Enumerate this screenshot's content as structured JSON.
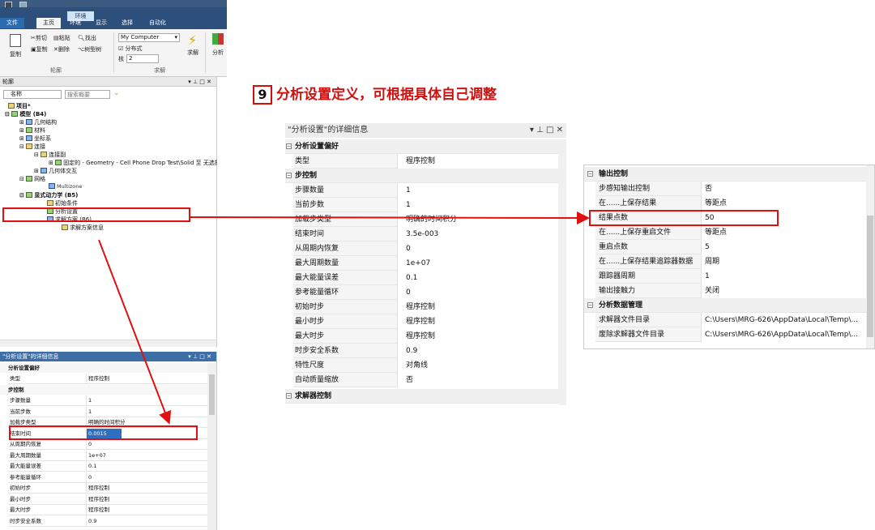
{
  "ribbon": {
    "context_tab": "环境",
    "tabs": [
      "文件",
      "主页",
      "环境",
      "显示",
      "选择",
      "自动化"
    ],
    "clipboard": {
      "copy": "复制",
      "cut": "剪切",
      "paste": "粘贴",
      "duplicate": "复制",
      "delete": "删除",
      "find": "找出",
      "tree": "树型树"
    },
    "group_outline": "轮廓",
    "computer_combo": "My Computer",
    "distributed": "分布式",
    "cores_label": "核",
    "cores_value": "2",
    "solve": "求解",
    "group_solve": "求解",
    "analysis": "分析"
  },
  "outline": {
    "title": "轮廓",
    "name_label": "名称",
    "search_placeholder": "搜索概要",
    "tree": [
      {
        "label": "项目*"
      },
      {
        "label": "模型 (B4)"
      },
      {
        "label": "几何结构"
      },
      {
        "label": "材料"
      },
      {
        "label": "坐标系"
      },
      {
        "label": "连接"
      },
      {
        "label": "连接副"
      },
      {
        "label": "固定的 - Geometry - Cell Phone Drop Test\\Solid 至 无选择"
      },
      {
        "label": "几何体交互"
      },
      {
        "label": "网格"
      },
      {
        "label": "Multizone"
      },
      {
        "label": "显式动力学 (B5)"
      },
      {
        "label": "初始条件"
      },
      {
        "label": "分析设置"
      },
      {
        "label": "求解方案 (B6)"
      },
      {
        "label": "求解方案信息"
      }
    ]
  },
  "small_details": {
    "title": "\"分析设置\"的详细信息",
    "group1": "分析设置偏好",
    "group2": "步控制",
    "rows_top": [
      {
        "k": "类型",
        "v": "程序控制"
      }
    ],
    "rows": [
      {
        "k": "步骤数量",
        "v": "1"
      },
      {
        "k": "当前步数",
        "v": "1"
      },
      {
        "k": "加载步类型",
        "v": "明确的时间积分"
      },
      {
        "k": "结束时间",
        "v": "0.0015"
      },
      {
        "k": "从周期内恢复",
        "v": "0"
      },
      {
        "k": "最大周期数量",
        "v": "1e+07"
      },
      {
        "k": "最大能量误差",
        "v": "0.1"
      },
      {
        "k": "参考能量循环",
        "v": "0"
      },
      {
        "k": "初始时步",
        "v": "程序控制"
      },
      {
        "k": "最小时步",
        "v": "程序控制"
      },
      {
        "k": "最大时步",
        "v": "程序控制"
      },
      {
        "k": "时步安全系数",
        "v": "0.9"
      }
    ]
  },
  "main_details": {
    "title": "\"分析设置\"的详细信息",
    "group1": "分析设置偏好",
    "group2": "步控制",
    "group3": "求解器控制",
    "rows_top": [
      {
        "k": "类型",
        "v": "程序控制"
      }
    ],
    "rows": [
      {
        "k": "步骤数量",
        "v": "1"
      },
      {
        "k": "当前步数",
        "v": "1"
      },
      {
        "k": "加载步类型",
        "v": "明确的时间积分"
      },
      {
        "k": "结束时间",
        "v": "3.5e-003"
      },
      {
        "k": "从周期内恢复",
        "v": "0"
      },
      {
        "k": "最大周期数量",
        "v": "1e+07"
      },
      {
        "k": "最大能量误差",
        "v": "0.1"
      },
      {
        "k": "参考能量循环",
        "v": "0"
      },
      {
        "k": "初始时步",
        "v": "程序控制"
      },
      {
        "k": "最小时步",
        "v": "程序控制"
      },
      {
        "k": "最大时步",
        "v": "程序控制"
      },
      {
        "k": "时步安全系数",
        "v": "0.9"
      },
      {
        "k": "特性尺度",
        "v": "对角线"
      },
      {
        "k": "自动质量缩放",
        "v": "否"
      }
    ]
  },
  "right_details": {
    "group1": "输出控制",
    "group2": "分析数据管理",
    "rows1": [
      {
        "k": "步感知输出控制",
        "v": "否"
      },
      {
        "k": "在......上保存结果",
        "v": "等距点"
      },
      {
        "k": "结果点数",
        "v": "50"
      },
      {
        "k": "在......上保存重启文件",
        "v": "等距点"
      },
      {
        "k": "重启点数",
        "v": "5"
      },
      {
        "k": "在......上保存结果追踪器数据",
        "v": "周期"
      },
      {
        "k": "跟踪器周期",
        "v": "1"
      },
      {
        "k": "输出接触力",
        "v": "关闭"
      }
    ],
    "rows2": [
      {
        "k": "求解器文件目录",
        "v": "C:\\Users\\MRG-626\\AppData\\Local\\Temp\\..."
      },
      {
        "k": "废除求解器文件目录",
        "v": "C:\\Users\\MRG-626\\AppData\\Local\\Temp\\..."
      }
    ]
  },
  "annotation": {
    "step_number": "9",
    "step_text": "分析设置定义，可根据具体自己调整"
  },
  "colors": {
    "accent": "#2d4f7c",
    "highlight": "#e01010",
    "selection": "#2f6fc0"
  }
}
